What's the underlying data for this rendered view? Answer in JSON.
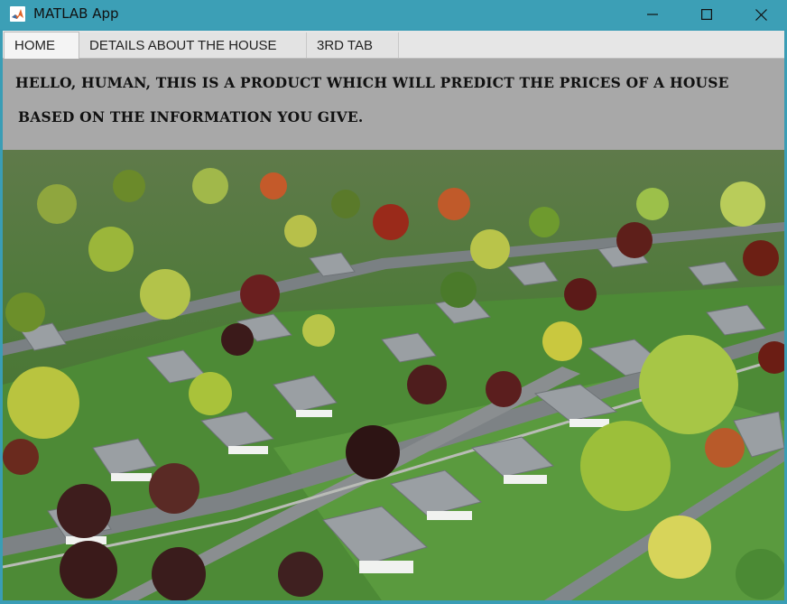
{
  "window": {
    "title": "MATLAB App",
    "controls": {
      "minimize": "minimize",
      "maximize": "maximize",
      "close": "close"
    }
  },
  "tabs": [
    {
      "label": "HOME",
      "active": true
    },
    {
      "label": "DETAILS ABOUT THE HOUSE",
      "active": false
    },
    {
      "label": "3RD TAB",
      "active": false
    }
  ],
  "home": {
    "line1": "HELLO, HUMAN, THIS IS A PRODUCT WHICH WILL PREDICT THE PRICES OF A HOUSE",
    "line2": "BASED ON THE INFORMATION YOU GIVE."
  },
  "colors": {
    "titlebar": "#3c9fb6",
    "panel": "#a8a8a8",
    "tabstrip": "#e6e6e6"
  }
}
